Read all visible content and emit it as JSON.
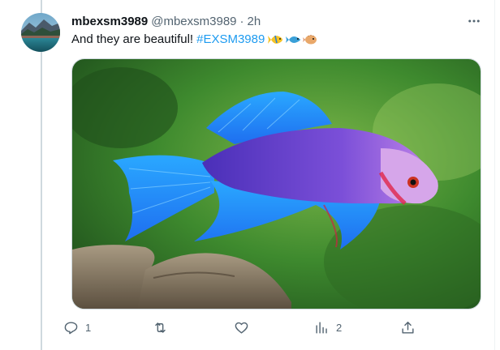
{
  "tweet": {
    "display_name": "mbexsm3989",
    "handle": "@mbexsm3989",
    "separator": "·",
    "time": "2h",
    "text": "And they are beautiful!",
    "hashtag": "#EXSM3989",
    "emojis": [
      "tropical-fish",
      "fish",
      "blowfish"
    ]
  },
  "actions": {
    "reply_count": "1",
    "repost_count": "",
    "like_count": "",
    "views_count": "2"
  },
  "colors": {
    "accent": "#1d9bf0",
    "text_primary": "#0f1419",
    "text_secondary": "#536471",
    "border": "#cfd9de"
  },
  "media": {
    "subject": "blue-purple betta fish"
  }
}
